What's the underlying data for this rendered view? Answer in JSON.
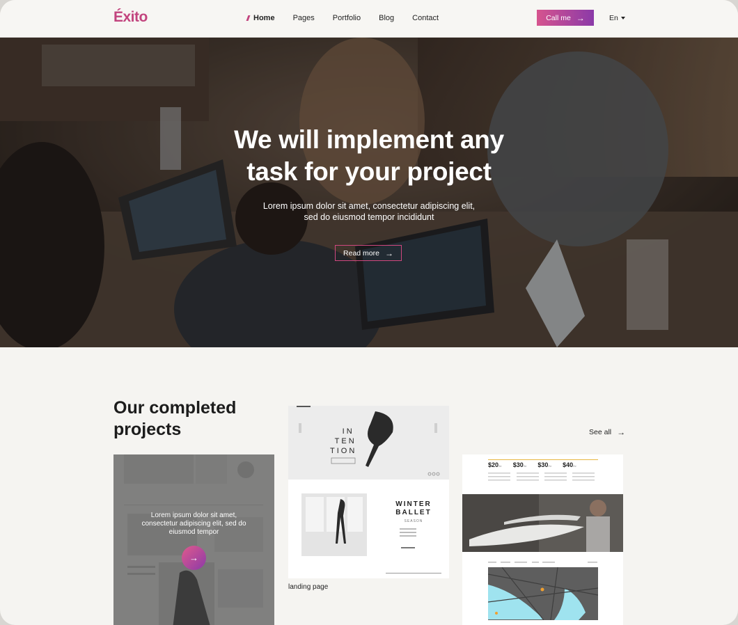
{
  "header": {
    "logo": "Éxito",
    "nav": [
      "Home",
      "Pages",
      "Portfolio",
      "Blog",
      "Contact"
    ],
    "active_nav": "Home",
    "call_label": "Call me",
    "language": "En"
  },
  "hero": {
    "title_line1": "We will implement any",
    "title_line2": "task for your project",
    "subtitle_line1": "Lorem ipsum dolor sit amet, consectetur adipiscing elit,",
    "subtitle_line2": "sed do eiusmod tempor incididunt",
    "read_more_label": "Read more"
  },
  "projects": {
    "title_line1": "Our completed",
    "title_line2": "projects",
    "see_all_label": "See all",
    "card1_text": "Lorem ipsum dolor sit amet, consectetur adipiscing elit, sed do eiusmod tempor",
    "card2_caption": "landing page",
    "card2_intention": [
      "IN",
      "TEN",
      "TION"
    ],
    "card2_winter": [
      "WINTER",
      "BALLET"
    ],
    "card2_season": "SEASON",
    "card3_prices": [
      {
        "value": "$20",
        "unit": "/hr"
      },
      {
        "value": "$30",
        "unit": "/hr"
      },
      {
        "value": "$30",
        "unit": "/hr"
      },
      {
        "value": "$40",
        "unit": "/hr"
      }
    ]
  },
  "colors": {
    "accent": "#c2447e",
    "gradient_start": "#d6548e",
    "gradient_end": "#8b3aa8",
    "background": "#f5f4f1"
  },
  "icons": {
    "arrow": "arrow-right-icon",
    "caret": "caret-down-icon"
  }
}
